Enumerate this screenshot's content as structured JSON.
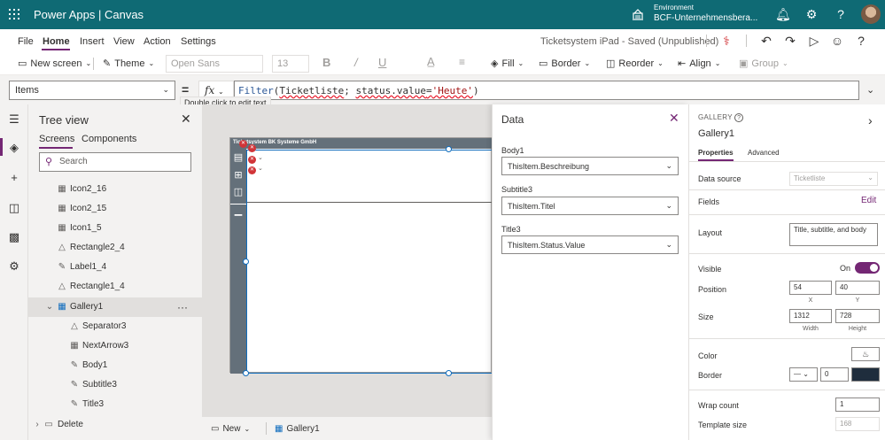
{
  "topbar": {
    "app_name": "Power Apps  |  Canvas",
    "env_label": "Environment",
    "env_name": "BCF-Unternehmensbera..."
  },
  "menu": {
    "items": [
      "File",
      "Home",
      "Insert",
      "View",
      "Action",
      "Settings"
    ],
    "save_status": "Ticketsystem iPad - Saved (Unpublished)"
  },
  "ribbon": {
    "new_screen": "New screen",
    "theme": "Theme",
    "font": "Open Sans",
    "font_size": "13",
    "fill": "Fill",
    "border": "Border",
    "reorder": "Reorder",
    "align": "Align",
    "group": "Group"
  },
  "formula": {
    "property": "Items",
    "equals": "=",
    "fx": "fx",
    "fn": "Filter",
    "open": "(",
    "arg1": "Ticketliste",
    "sep": "; ",
    "arg2": "status.value",
    "eq": "=",
    "str": "'Heute'",
    "close": ")",
    "tooltip": "Double click to edit text"
  },
  "tree": {
    "title": "Tree view",
    "tabs": [
      "Screens",
      "Components"
    ],
    "search_placeholder": "Search",
    "items": [
      {
        "label": "Icon2_16",
        "icon": "icon-control"
      },
      {
        "label": "Icon2_15",
        "icon": "icon-control"
      },
      {
        "label": "Icon1_5",
        "icon": "icon-control"
      },
      {
        "label": "Rectangle2_4",
        "icon": "rectangle"
      },
      {
        "label": "Label1_4",
        "icon": "label"
      },
      {
        "label": "Rectangle1_4",
        "icon": "rectangle"
      },
      {
        "label": "Gallery1",
        "icon": "gallery"
      },
      {
        "label": "Separator3",
        "icon": "rectangle"
      },
      {
        "label": "NextArrow3",
        "icon": "icon-control"
      },
      {
        "label": "Body1",
        "icon": "label"
      },
      {
        "label": "Subtitle3",
        "icon": "label"
      },
      {
        "label": "Title3",
        "icon": "label"
      },
      {
        "label": "Delete",
        "icon": "screen"
      }
    ],
    "more": "···"
  },
  "canvas": {
    "header_text": "Ticketsystem BK Systeme GmbH",
    "bottom_new": "New",
    "bottom_gallery": "Gallery1"
  },
  "data_panel": {
    "title": "Data",
    "fields": [
      {
        "label": "Body1",
        "value": "ThisItem.Beschreibung"
      },
      {
        "label": "Subtitle3",
        "value": "ThisItem.Titel"
      },
      {
        "label": "Title3",
        "value": "ThisItem.Status.Value"
      }
    ]
  },
  "properties": {
    "type": "GALLERY",
    "name": "Gallery1",
    "tabs": [
      "Properties",
      "Advanced"
    ],
    "data_source_label": "Data source",
    "data_source_value": "Ticketliste",
    "fields_label": "Fields",
    "fields_edit": "Edit",
    "layout_label": "Layout",
    "layout_value": "Title, subtitle, and body",
    "visible_label": "Visible",
    "visible_value": "On",
    "position_label": "Position",
    "pos_x": "54",
    "pos_y": "40",
    "x_label": "X",
    "y_label": "Y",
    "size_label": "Size",
    "width": "1312",
    "height": "728",
    "width_label": "Width",
    "height_label": "Height",
    "color_label": "Color",
    "border_label": "Border",
    "border_width": "0",
    "border_color": "#1f2d3d",
    "wrap_label": "Wrap count",
    "wrap_value": "1",
    "template_label": "Template size",
    "template_value": "168"
  },
  "colors": {
    "topbar": "#0f6a74",
    "accent": "#742774",
    "selection": "#0f6cbd",
    "error": "#d13438"
  }
}
